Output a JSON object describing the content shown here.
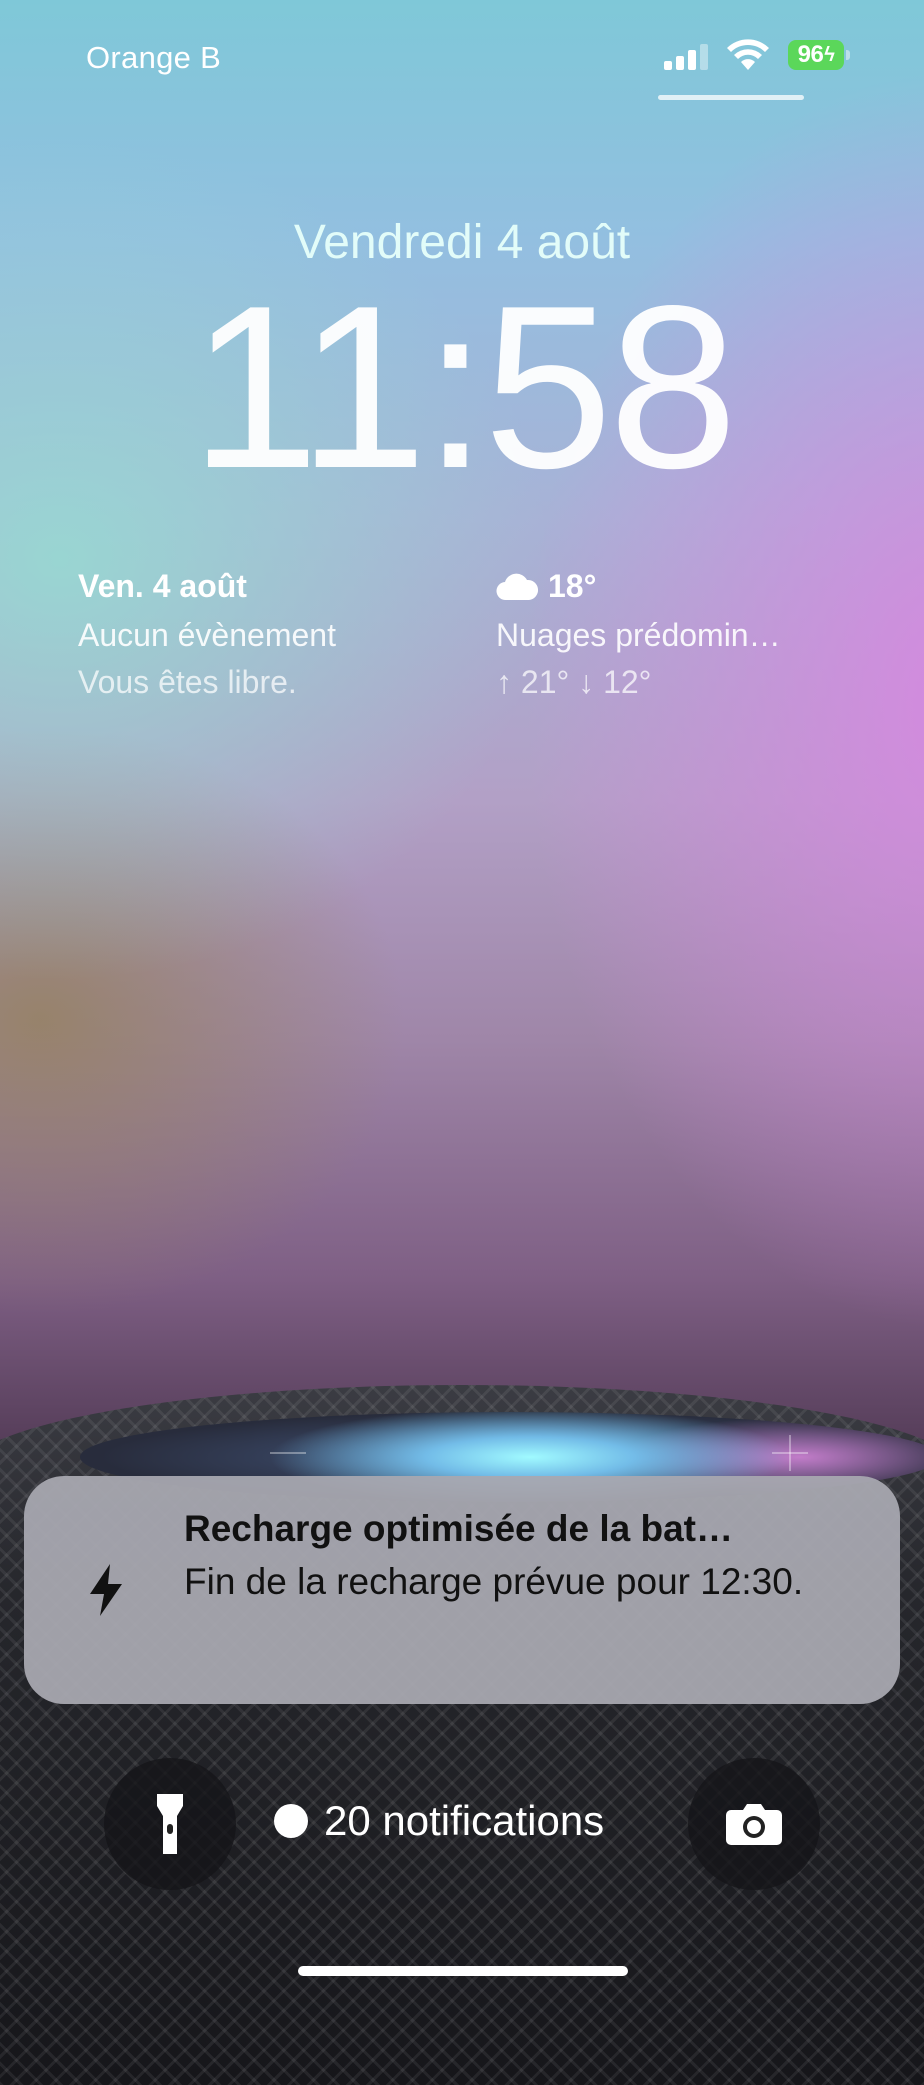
{
  "status_bar": {
    "carrier": "Orange B",
    "battery_level": "96",
    "battery_charging": true,
    "signal_bars": 3,
    "icons": [
      "signal-icon",
      "wifi-icon",
      "battery-charging-icon"
    ]
  },
  "lock_screen": {
    "date": "Vendredi 4 août",
    "time": "11:58"
  },
  "widgets": {
    "calendar": {
      "date": "Ven. 4 août",
      "event": "Aucun évènement",
      "subtitle": "Vous êtes libre."
    },
    "weather": {
      "icon": "cloud-icon",
      "temperature": "18°",
      "condition": "Nuages prédomin…",
      "high_low": "↑ 21° ↓ 12°"
    }
  },
  "notification": {
    "icon": "bolt-icon",
    "title": "Recharge optimisée de la bat…",
    "body": "Fin de la recharge prévue pour 12:30."
  },
  "bottom_bar": {
    "flashlight_icon": "flashlight-icon",
    "notification_count": "20 notifications",
    "camera_icon": "camera-icon"
  },
  "colors": {
    "battery": "#5bd75a",
    "notification_bg": "#a8a8b0"
  }
}
